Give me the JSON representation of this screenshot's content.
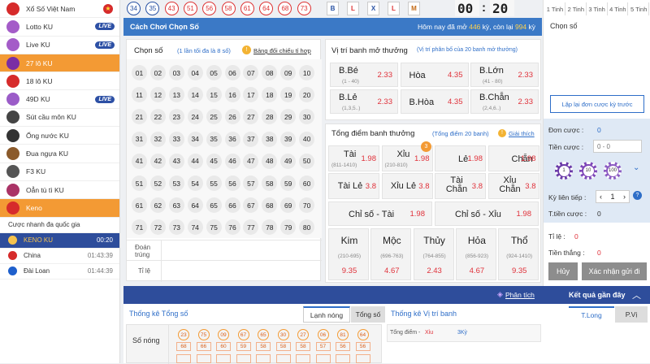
{
  "sidebar": {
    "items": [
      {
        "label": "Xổ Số Việt Nam",
        "icon": "vietnam-flag-icon",
        "live": "",
        "color": "#d62b2b"
      },
      {
        "label": "Lotto KU",
        "icon": "lotto-girl-icon",
        "live": "LIVE",
        "color": "#a45cc8"
      },
      {
        "label": "Live KU",
        "icon": "live-girl-icon",
        "live": "LIVE",
        "color": "#a45cc8"
      },
      {
        "label": "27 lô KU",
        "icon": "ball-27-icon",
        "live": "",
        "color": "#7a2ea5"
      },
      {
        "label": "18 lô KU",
        "icon": "ball-18-icon",
        "live": "",
        "color": "#d62b2b"
      },
      {
        "label": "49D KU",
        "icon": "49d-icon",
        "live": "LIVE",
        "color": "#9b5cc8"
      },
      {
        "label": "Sút cầu môn KU",
        "icon": "soccer-goal-icon",
        "live": "",
        "color": "#444"
      },
      {
        "label": "Ống nước KU",
        "icon": "pipe-icon",
        "live": "",
        "color": "#333"
      },
      {
        "label": "Đua ngựa KU",
        "icon": "horse-icon",
        "live": "",
        "color": "#8b5a2b"
      },
      {
        "label": "F3 KU",
        "icon": "car-icon",
        "live": "",
        "color": "#555"
      },
      {
        "label": "Oẳn tù tì KU",
        "icon": "hand-icon",
        "live": "",
        "color": "#a36"
      },
      {
        "label": "Keno",
        "icon": "keno-icon",
        "live": "",
        "color": "#d62b2b"
      }
    ],
    "keno_sub": [
      {
        "label": "Cược nhanh đa quốc gia",
        "time": ""
      },
      {
        "label": "KENO KU",
        "time": "00:20"
      },
      {
        "label": "China",
        "time": "01:43:39"
      },
      {
        "label": "Đài Loan",
        "time": "01:44:39"
      }
    ]
  },
  "top": {
    "results": [
      "34",
      "35",
      "43",
      "51",
      "56",
      "58",
      "61",
      "64",
      "68",
      "73"
    ],
    "letters": [
      "B",
      "L",
      "X",
      "L",
      "M"
    ],
    "timer_min": "00",
    "timer_sep": ":",
    "timer_sec": "20",
    "tinh_tabs": [
      "1 Tinh",
      "2 Tinh",
      "3 Tinh",
      "4 Tinh",
      "5 Tinh"
    ]
  },
  "bar": {
    "mode": "Cách Chơi Chọn Số",
    "info_prefix": "Hôm nay đã mở ",
    "opened": "446",
    "info_mid": " kỳ, còn lại ",
    "remaining": "994",
    "info_suffix": " kỳ"
  },
  "pick": {
    "title": "Chọn số",
    "hint": "(1 lần tối đa là 8 số)",
    "table_link": "Bảng đối chiếu tỉ hợp",
    "numbers": [
      "01",
      "02",
      "03",
      "04",
      "05",
      "06",
      "07",
      "08",
      "09",
      "10",
      "11",
      "12",
      "13",
      "14",
      "15",
      "16",
      "17",
      "18",
      "19",
      "20",
      "21",
      "22",
      "23",
      "24",
      "25",
      "26",
      "27",
      "28",
      "29",
      "30",
      "31",
      "32",
      "33",
      "34",
      "35",
      "36",
      "37",
      "38",
      "39",
      "40",
      "41",
      "42",
      "43",
      "44",
      "45",
      "46",
      "47",
      "48",
      "49",
      "50",
      "51",
      "52",
      "53",
      "54",
      "55",
      "56",
      "57",
      "58",
      "59",
      "60",
      "61",
      "62",
      "63",
      "64",
      "65",
      "66",
      "67",
      "68",
      "69",
      "70",
      "71",
      "72",
      "73",
      "74",
      "75",
      "76",
      "77",
      "78",
      "79",
      "80"
    ],
    "row_label_hit": "Đoán trúng",
    "row_label_rate": "Tỉ lệ"
  },
  "position": {
    "title": "Vị trí banh mở thưởng",
    "hint": "(Vị trí phân bố của 20 banh mở thưởng)",
    "cells": [
      {
        "label": "B.Bé",
        "sub": "(1 - 40)",
        "odd": "2.33"
      },
      {
        "label": "Hòa",
        "sub": "",
        "odd": "4.35"
      },
      {
        "label": "B.Lớn",
        "sub": "(41 - 80)",
        "odd": "2.33"
      },
      {
        "label": "B.Lẻ",
        "sub": "(1,3,5..)",
        "odd": "2.33"
      },
      {
        "label": "B.Hòa",
        "sub": "",
        "odd": "4.35"
      },
      {
        "label": "B.Chẵn",
        "sub": "(2,4,6..)",
        "odd": "2.33"
      }
    ]
  },
  "total": {
    "title": "Tổng điểm banh thưởng",
    "hint": "(Tổng điểm 20 banh)",
    "explain": "Giải thích",
    "badge": "3",
    "row1": [
      {
        "label": "Tài",
        "sub": "(811-1410)",
        "odd": "1.98"
      },
      {
        "label": "Xỉu",
        "sub": "(210-810)",
        "odd": "1.98"
      },
      {
        "label": "Lẻ",
        "sub": "",
        "odd": "1.98"
      },
      {
        "label": "Chẵn",
        "sub": "",
        "odd": "1.98"
      }
    ],
    "row2": [
      {
        "label": "Tài Lẻ",
        "odd": "3.8"
      },
      {
        "label": "Xỉu Lẻ",
        "odd": "3.8"
      },
      {
        "label": "Tài Chẵn",
        "odd": "3.8"
      },
      {
        "label": "Xỉu Chẵn",
        "odd": "3.8"
      }
    ],
    "row3": [
      {
        "label": "Chỉ số - Tài",
        "odd": "1.98"
      },
      {
        "label": "Chỉ số - Xỉu",
        "odd": "1.98"
      }
    ],
    "elements": [
      {
        "label": "Kim",
        "sub": "(210-695)",
        "odd": "9.35"
      },
      {
        "label": "Mộc",
        "sub": "(696-763)",
        "odd": "4.67"
      },
      {
        "label": "Thủy",
        "sub": "(764-855)",
        "odd": "2.43"
      },
      {
        "label": "Hỏa",
        "sub": "(856-923)",
        "odd": "4.67"
      },
      {
        "label": "Thổ",
        "sub": "(924-1410)",
        "odd": "9.35"
      }
    ]
  },
  "right": {
    "chosen_label": "Chọn số",
    "repeat_btn": "Lặp lại đơn cược kỳ trước",
    "order_label": "Đơn cược :",
    "order_val": "0",
    "money_label": "Tiền cược :",
    "money_placeholder": "0 - 0",
    "chips": [
      "1",
      "10",
      "100"
    ],
    "continuous_label": "Kỳ liên tiếp :",
    "continuous_val": "1",
    "total_money_label": "T.tiền cược :",
    "total_money_val": "0",
    "rate_label": "Tỉ lệ :",
    "rate_val": "0",
    "win_label": "Tiền thắng :",
    "win_val": "0",
    "cancel": "Hủy",
    "confirm": "Xác nhận gửi đi"
  },
  "bottom": {
    "analysis": "Phân tích",
    "recent": "Kết quả gần đây",
    "stats_total": "Thống kê Tổng số",
    "cold_hot": "Lạnh nóng",
    "total_tab": "Tổng số",
    "stats_pos": "Thống kê Vị trí banh",
    "tlong": "T.Long",
    "pvi": "P.Vị",
    "hot_label": "Số nóng",
    "hot_numbers": [
      "23",
      "75",
      "09",
      "67",
      "65",
      "30",
      "27",
      "06",
      "81",
      "64"
    ],
    "hot_counts": [
      "68",
      "66",
      "60",
      "59",
      "58",
      "58",
      "58",
      "57",
      "56",
      "56"
    ],
    "total_point_label": "Tổng điểm -",
    "total_point_val": "Xỉu",
    "total_point_ky": "3Kỳ"
  },
  "colors": {
    "accent_orange": "#f39a34",
    "bar_blue": "#3b79c6",
    "odd_red": "#e0313a",
    "navy": "#2e4d9b"
  }
}
